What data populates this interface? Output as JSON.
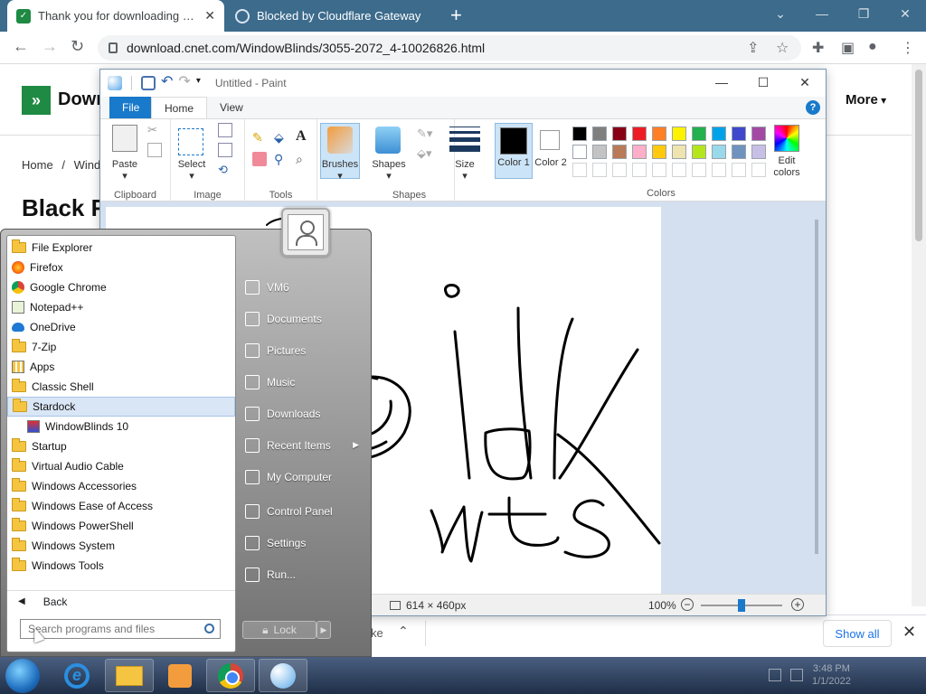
{
  "browser": {
    "tabs": [
      {
        "title": "Thank you for downloading Winc",
        "active": true
      },
      {
        "title": "Blocked by Cloudflare Gateway",
        "active": false
      }
    ],
    "url": "download.cnet.com/WindowBlinds/3055-2072_4-10026826.html"
  },
  "cnet": {
    "brand": "Down",
    "more": "More",
    "breadcrumb_home": "Home",
    "breadcrumb_sep": "/",
    "breadcrumb_next": "Windo",
    "heading": "Black F"
  },
  "download_bar": {
    "fragment": "ke",
    "show_all": "Show all"
  },
  "paint": {
    "title": "Untitled - Paint",
    "tabs": {
      "file": "File",
      "home": "Home",
      "view": "View"
    },
    "groups": {
      "clipboard": "Clipboard",
      "image": "Image",
      "tools": "Tools",
      "shapes": "Shapes",
      "colors": "Colors"
    },
    "tools": {
      "paste": "Paste",
      "select": "Select",
      "brushes": "Brushes",
      "shapes": "Shapes",
      "size": "Size",
      "color1": "Color 1",
      "color2": "Color 2",
      "edit_colors": "Edit colors"
    },
    "palette_row1": [
      "#000000",
      "#7f7f7f",
      "#880015",
      "#ed1c24",
      "#ff7f27",
      "#fff200",
      "#22b14c",
      "#00a2e8",
      "#3f48cc",
      "#a349a4"
    ],
    "palette_row2": [
      "#ffffff",
      "#c3c3c3",
      "#b97a57",
      "#ffaec9",
      "#ffc90e",
      "#efe4b0",
      "#b5e61d",
      "#99d9ea",
      "#7092be",
      "#c8bfe7"
    ],
    "status": {
      "size": "614 × 460px",
      "zoom": "100%",
      "zoom_level": 0.5
    }
  },
  "start_menu": {
    "programs": [
      {
        "label": "File Explorer",
        "icon": "folder-icon",
        "kind": "folder"
      },
      {
        "label": "Firefox",
        "icon": "firefox-icon",
        "kind": "firefox"
      },
      {
        "label": "Google Chrome",
        "icon": "chrome-icon",
        "kind": "chrome"
      },
      {
        "label": "Notepad++",
        "icon": "notepadpp-icon",
        "kind": "notepad"
      },
      {
        "label": "OneDrive",
        "icon": "onedrive-icon",
        "kind": "onedrive"
      },
      {
        "label": "7-Zip",
        "icon": "folder-icon",
        "kind": "folder"
      },
      {
        "label": "Apps",
        "icon": "apps-icon",
        "kind": "apps"
      },
      {
        "label": "Classic Shell",
        "icon": "folder-icon",
        "kind": "folder"
      },
      {
        "label": "Stardock",
        "icon": "folder-icon",
        "kind": "folder",
        "hover": true
      },
      {
        "label": "WindowBlinds 10",
        "icon": "windowblinds-icon",
        "kind": "wb",
        "sub": true
      },
      {
        "label": "Startup",
        "icon": "folder-icon",
        "kind": "folder"
      },
      {
        "label": "Virtual Audio Cable",
        "icon": "folder-icon",
        "kind": "folder"
      },
      {
        "label": "Windows Accessories",
        "icon": "folder-icon",
        "kind": "folder"
      },
      {
        "label": "Windows Ease of Access",
        "icon": "folder-icon",
        "kind": "folder"
      },
      {
        "label": "Windows PowerShell",
        "icon": "folder-icon",
        "kind": "folder"
      },
      {
        "label": "Windows System",
        "icon": "folder-icon",
        "kind": "folder"
      },
      {
        "label": "Windows Tools",
        "icon": "folder-icon",
        "kind": "folder"
      }
    ],
    "back": "Back",
    "search_placeholder": "Search programs and files",
    "places": [
      {
        "label": "VM6",
        "icon": "folder-user-icon"
      },
      {
        "label": "Documents",
        "icon": "documents-icon"
      },
      {
        "label": "Pictures",
        "icon": "pictures-icon"
      },
      {
        "label": "Music",
        "icon": "music-icon"
      },
      {
        "label": "Downloads",
        "icon": "downloads-icon"
      },
      {
        "label": "Recent Items",
        "icon": "recent-icon",
        "submenu": true
      },
      {
        "label": "My Computer",
        "icon": "computer-icon"
      },
      {
        "label": "Control Panel",
        "icon": "control-panel-icon"
      },
      {
        "label": "Settings",
        "icon": "settings-icon"
      },
      {
        "label": "Run...",
        "icon": "run-icon"
      }
    ],
    "lock": "Lock"
  },
  "taskbar": {
    "clock_time": "3:48 PM",
    "clock_date": "1/1/2022"
  }
}
